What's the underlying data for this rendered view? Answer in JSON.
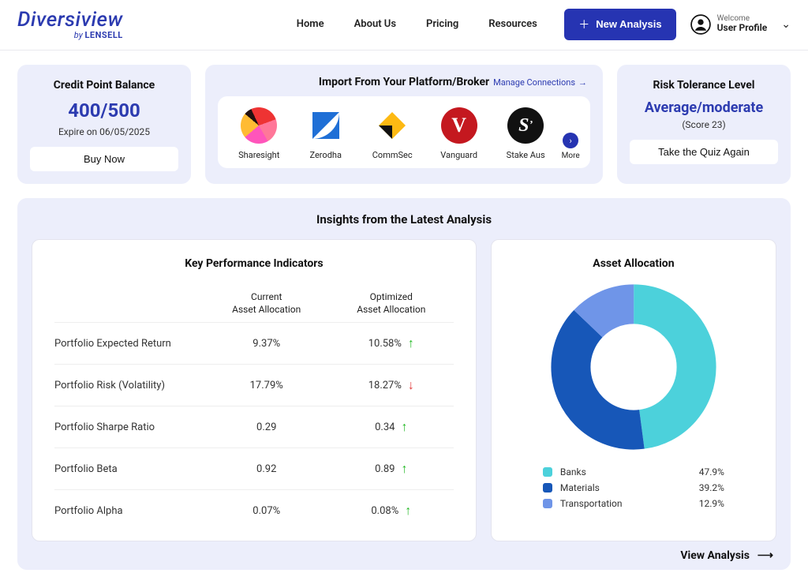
{
  "brand": {
    "main": "Diversiview",
    "sub_prefix": "by ",
    "sub_bold": "LENSELL"
  },
  "nav": {
    "home": "Home",
    "about": "About Us",
    "pricing": "Pricing",
    "resources": "Resources"
  },
  "header": {
    "new_analysis": "New Analysis",
    "welcome": "Welcome",
    "profile_name": "User Profile"
  },
  "credit": {
    "title": "Credit Point Balance",
    "value": "400/500",
    "expire": "Expire on 06/05/2025",
    "buy": "Buy Now"
  },
  "import": {
    "title": "Import From Your Platform/Broker",
    "manage": "Manage Connections",
    "brokers": {
      "sharesight": "Sharesight",
      "zerodha": "Zerodha",
      "commsec": "CommSec",
      "vanguard": "Vanguard",
      "stake": "Stake Aus"
    },
    "more": "More"
  },
  "risk": {
    "title": "Risk Tolerance Level",
    "level": "Average/moderate",
    "score": "(Score 23)",
    "quiz": "Take the Quiz Again"
  },
  "insights": {
    "title": "Insights from the Latest Analysis",
    "kpi_title": "Key Performance Indicators",
    "col_current_l1": "Current",
    "col_current_l2": "Asset Allocation",
    "col_opt_l1": "Optimized",
    "col_opt_l2": "Asset Allocation",
    "rows": [
      {
        "label": "Portfolio Expected Return",
        "current": "9.37%",
        "optimized": "10.58%",
        "dir": "up"
      },
      {
        "label": "Portfolio Risk (Volatility)",
        "current": "17.79%",
        "optimized": "18.27%",
        "dir": "down"
      },
      {
        "label": "Portfolio Sharpe Ratio",
        "current": "0.29",
        "optimized": "0.34",
        "dir": "up"
      },
      {
        "label": "Portfolio Beta",
        "current": "0.92",
        "optimized": "0.89",
        "dir": "up"
      },
      {
        "label": "Portfolio Alpha",
        "current": "0.07%",
        "optimized": "0.08%",
        "dir": "up"
      }
    ],
    "alloc_title": "Asset Allocation",
    "view": "View Analysis"
  },
  "chart_data": {
    "type": "pie",
    "title": "Asset Allocation",
    "series": [
      {
        "name": "Banks",
        "value": 47.9,
        "color": "#4cd1db",
        "display": "47.9%"
      },
      {
        "name": "Materials",
        "value": 39.2,
        "color": "#1757b8",
        "display": "39.2%"
      },
      {
        "name": "Transportation",
        "value": 12.9,
        "color": "#6f95e8",
        "display": "12.9%"
      }
    ]
  }
}
